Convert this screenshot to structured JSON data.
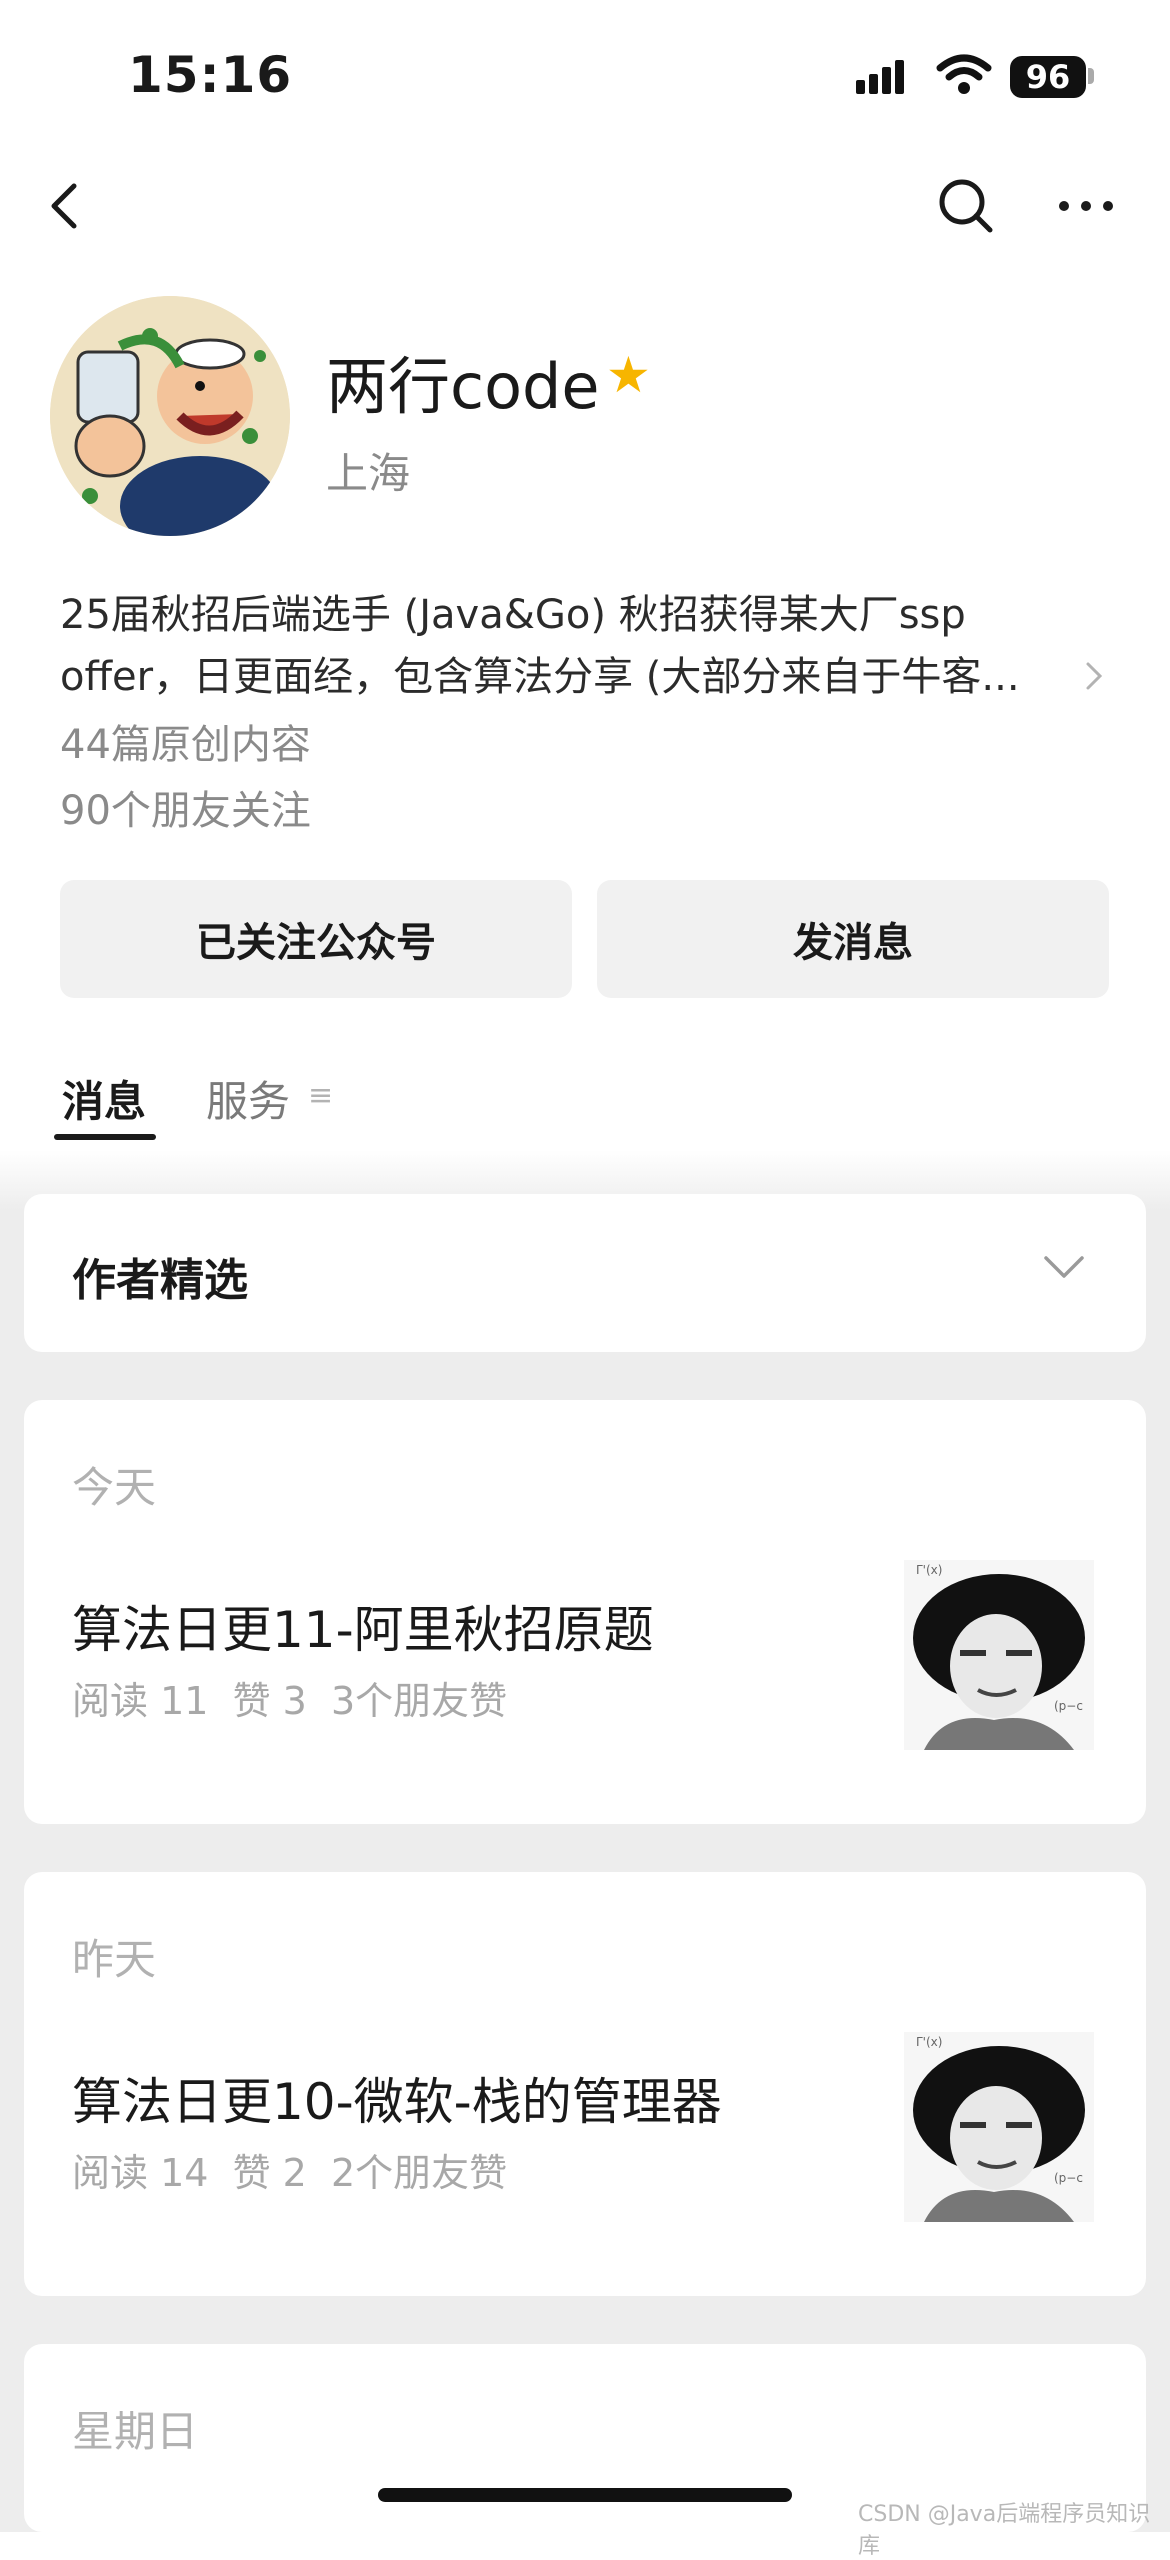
{
  "status_bar": {
    "time": "15:16",
    "battery": "96"
  },
  "nav": {
    "back_icon": "chevron-left-icon",
    "search_icon": "search-icon",
    "more_icon": "more-icon"
  },
  "profile": {
    "name": "两行code",
    "verified_icon": "star-icon",
    "location": "上海",
    "description_line1": "25届秋招后端选手 (Java&Go) 秋招获得某大厂ssp",
    "description_line2": "offer，日更面经，包含算法分享 (大部分来自于牛客...",
    "articles_count": "44篇原创内容",
    "followers": "90个朋友关注"
  },
  "actions": {
    "follow_label": "已关注公众号",
    "message_label": "发消息"
  },
  "tabs": [
    {
      "label": "消息"
    },
    {
      "label": "服务"
    }
  ],
  "tab_menu_glyph": "≡",
  "featured": {
    "title": "作者精选"
  },
  "feed": [
    {
      "date": "今天",
      "title": "算法日更11-阿里秋招原题",
      "meta": "阅读 11  赞 3  3个朋友赞"
    },
    {
      "date": "昨天",
      "title": "算法日更10-微软-栈的管理器",
      "meta": "阅读 14  赞 2  2个朋友赞"
    },
    {
      "date": "星期日"
    }
  ],
  "watermark": "CSDN @Java后端程序员知识库",
  "colors": {
    "accent_star": "#f7b500",
    "background_feed": "#ededed"
  }
}
